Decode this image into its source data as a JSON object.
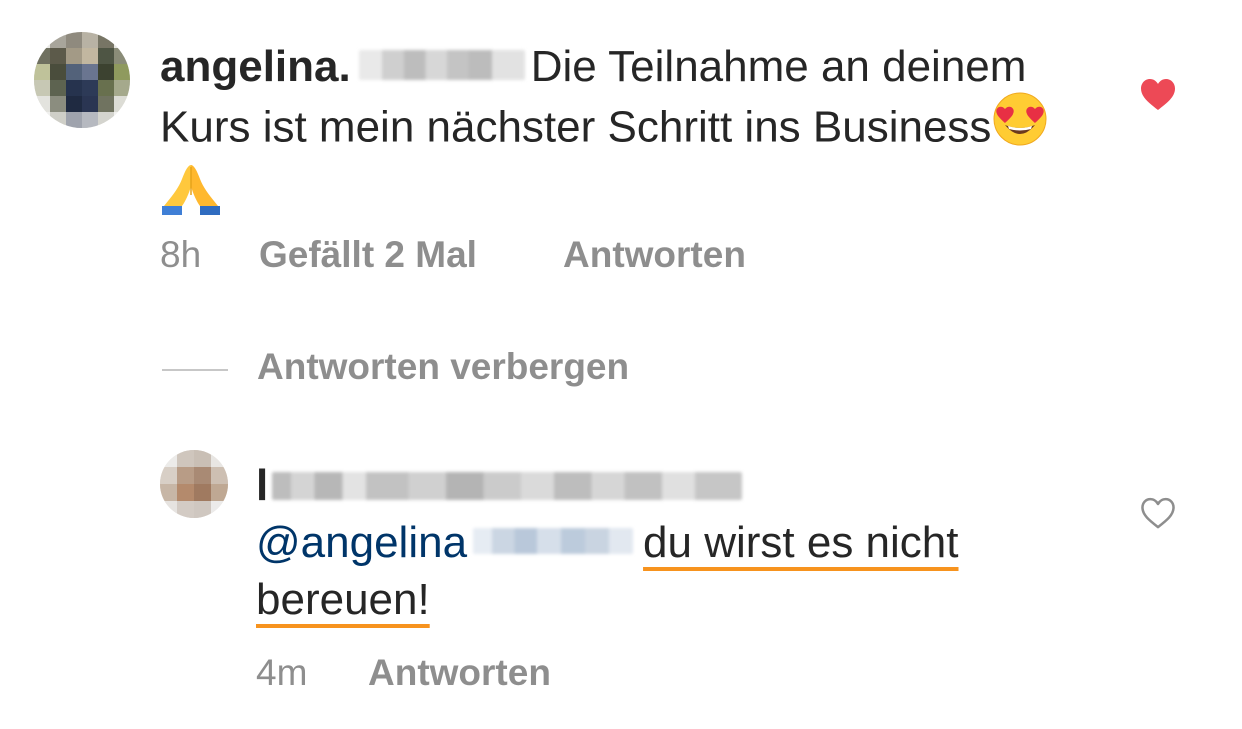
{
  "comment": {
    "username": "angelina.",
    "text": "Die Teilnahme an deinem Kurs ist mein nächster Schritt ins Business",
    "emojis": [
      "heart-eyes-emoji",
      "folded-hands-emoji"
    ],
    "time": "8h",
    "likes": "Gefällt 2 Mal",
    "reply_label": "Antworten",
    "liked": true,
    "like_color": "#ed4956"
  },
  "hide_replies_label": "Antworten verbergen",
  "reply": {
    "username_initial": "l",
    "mention": "@angelina",
    "text_part1": "du wirst es nicht",
    "text_part2": "bereuen!",
    "time": "4m",
    "reply_label": "Antworten",
    "liked": false,
    "underline_color": "#f7931e"
  },
  "colors": {
    "text": "#262626",
    "secondary": "#8e8e8e",
    "mention": "#003569"
  }
}
